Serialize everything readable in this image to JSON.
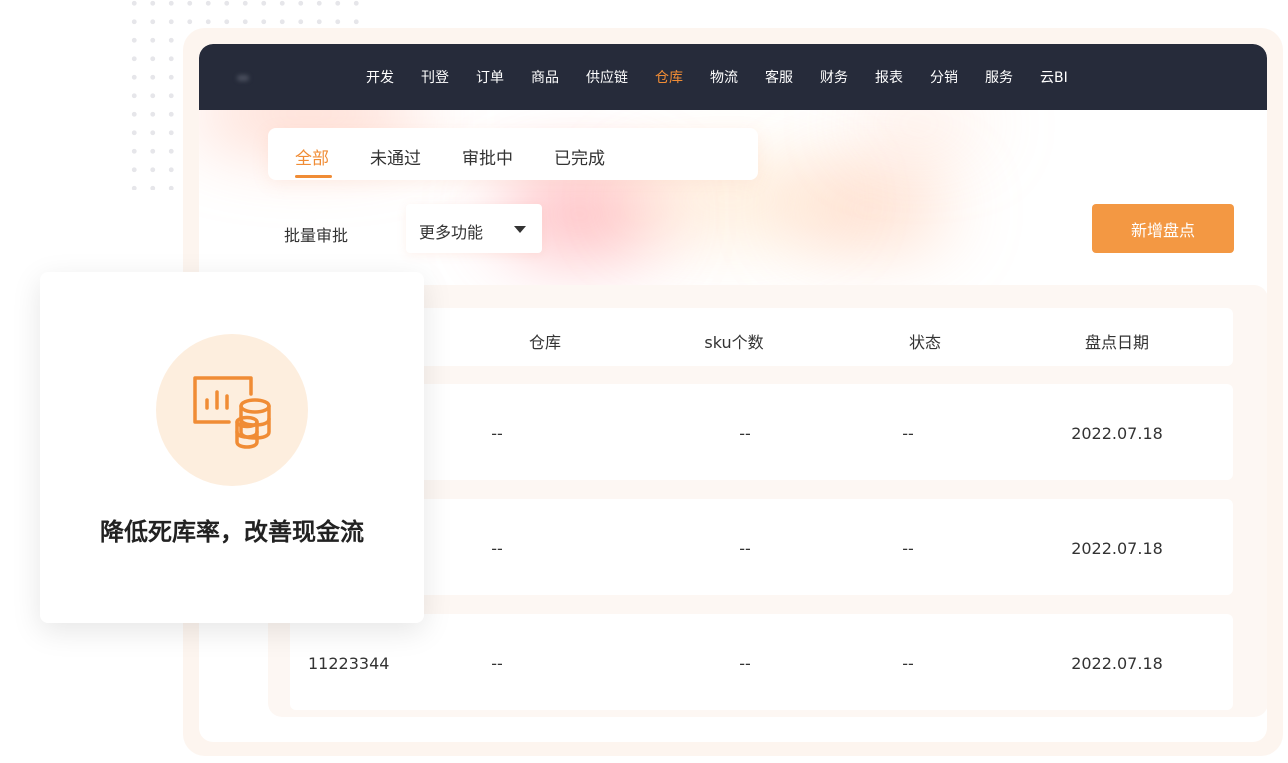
{
  "nav": {
    "items": [
      {
        "label": "开发",
        "active": false
      },
      {
        "label": "刊登",
        "active": false
      },
      {
        "label": "订单",
        "active": false
      },
      {
        "label": "商品",
        "active": false
      },
      {
        "label": "供应链",
        "active": false
      },
      {
        "label": "仓库",
        "active": true
      },
      {
        "label": "物流",
        "active": false
      },
      {
        "label": "客服",
        "active": false
      },
      {
        "label": "财务",
        "active": false
      },
      {
        "label": "报表",
        "active": false
      },
      {
        "label": "分销",
        "active": false
      },
      {
        "label": "服务",
        "active": false
      },
      {
        "label": "云BI",
        "active": false
      }
    ]
  },
  "tabs": {
    "items": [
      {
        "label": "全部",
        "active": true
      },
      {
        "label": "未通过",
        "active": false
      },
      {
        "label": "审批中",
        "active": false
      },
      {
        "label": "已完成",
        "active": false
      }
    ]
  },
  "toolbar": {
    "batch_approve_label": "批量审批",
    "more_label": "更多功能",
    "add_label": "新增盘点"
  },
  "table": {
    "columns": [
      "仓库",
      "sku个数",
      "状态",
      "盘点日期"
    ],
    "rows": [
      {
        "id": "",
        "warehouse": "--",
        "sku_count": "--",
        "status": "--",
        "date": "2022.07.18"
      },
      {
        "id": "",
        "warehouse": "--",
        "sku_count": "--",
        "status": "--",
        "date": "2022.07.18"
      },
      {
        "id": "11223344",
        "warehouse": "--",
        "sku_count": "--",
        "status": "--",
        "date": "2022.07.18"
      }
    ]
  },
  "feature": {
    "icon": "chart-coins-icon",
    "text": "降低死库率，改善现金流"
  },
  "colors": {
    "accent": "#f08c35",
    "navbar": "#262b3a",
    "button": "#f39843"
  }
}
